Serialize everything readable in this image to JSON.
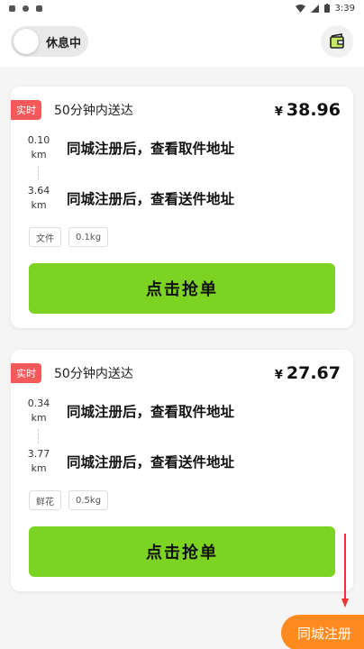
{
  "statusbar": {
    "time": "3:39"
  },
  "topbar": {
    "status_label": "休息中"
  },
  "orders": [
    {
      "tag": "实时",
      "eta": "50分钟内送达",
      "currency": "¥",
      "price": "38.96",
      "pickup": {
        "distance": "0.10",
        "unit": "km",
        "address": "同城注册后，查看取件地址"
      },
      "dropoff": {
        "distance": "3.64",
        "unit": "km",
        "address": "同城注册后，查看送件地址"
      },
      "category": "文件",
      "weight": "0.1kg",
      "button": "点击抢单"
    },
    {
      "tag": "实时",
      "eta": "50分钟内送达",
      "currency": "¥",
      "price": "27.67",
      "pickup": {
        "distance": "0.34",
        "unit": "km",
        "address": "同城注册后，查看取件地址"
      },
      "dropoff": {
        "distance": "3.77",
        "unit": "km",
        "address": "同城注册后，查看送件地址"
      },
      "category": "鲜花",
      "weight": "0.5kg",
      "button": "点击抢单"
    }
  ],
  "fab": {
    "label": "同城注册"
  },
  "colors": {
    "accent_green": "#7dd321",
    "tag_red": "#f45a5a",
    "fab_orange": "#ff8a1f"
  }
}
